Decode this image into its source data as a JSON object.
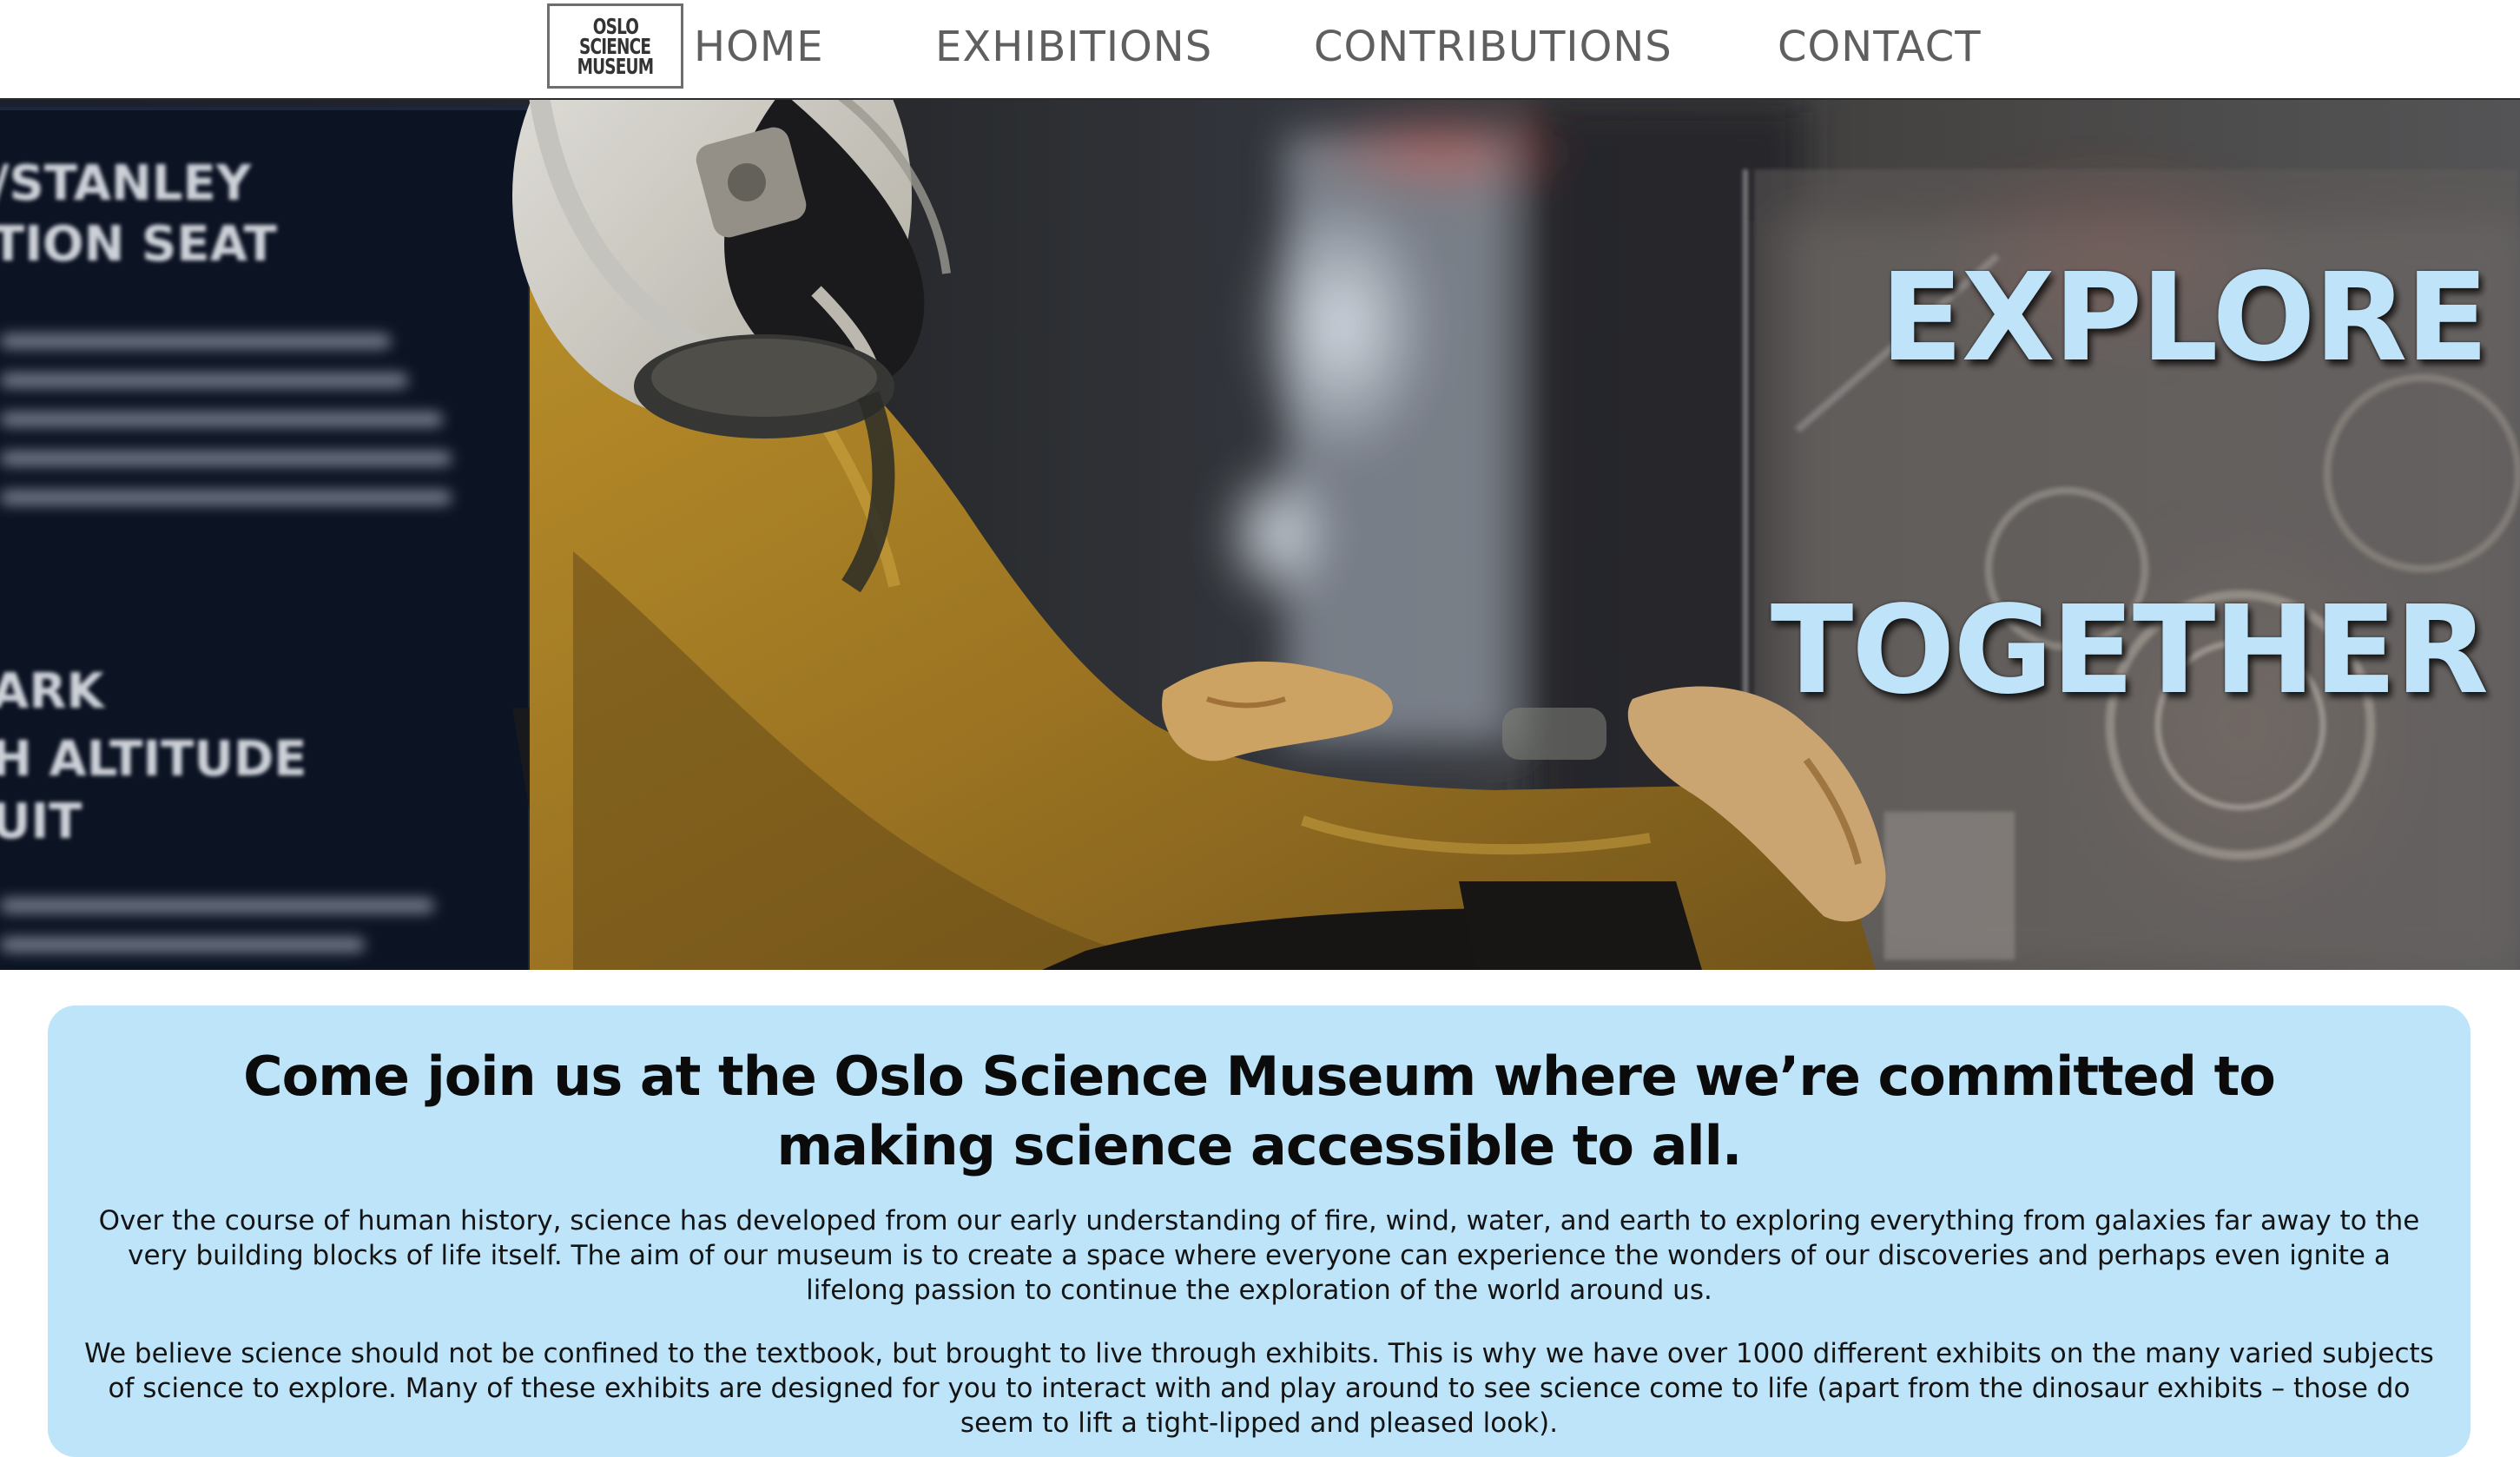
{
  "nav": {
    "logo": {
      "line1": "OSLO",
      "line2": "SCIENCE",
      "line3": "MUSEUM"
    },
    "items": [
      {
        "label": "HOME"
      },
      {
        "label": "EXHIBITIONS"
      },
      {
        "label": "CONTRIBUTIONS"
      },
      {
        "label": "CONTACT"
      }
    ]
  },
  "hero": {
    "word1": "EXPLORE",
    "word2": "TOGETHER",
    "image_subject": "pilot in yellow flight suit and helmet seated in a cockpit exhibit",
    "placard_text": {
      "line1": "/STANLEY",
      "line2": "TION SEAT",
      "line3": "ARK",
      "line4": "H ALTITUDE",
      "line5": "UIT"
    }
  },
  "intro": {
    "heading": "Come join us at the Oslo Science Museum where we’re committed to making science accessible to all.",
    "paragraph1": "Over the course of human history, science has developed from our early understanding of fire, wind, water, and earth to exploring everything from galaxies far away to the very building blocks of life itself. The aim of our museum is to create a space where everyone can experience the wonders of our discoveries and perhaps even ignite a lifelong passion to continue the exploration of the world around us.",
    "paragraph2": "We believe science should not be confined to the textbook, but brought to live through exhibits. This is why we have over 1000 different exhibits on the many varied subjects of science to explore. Many of these exhibits are designed for you to interact with and play around to see science come to life (apart from the dinosaur exhibits – those do seem to lift a tight-lipped and pleased look)."
  },
  "colors": {
    "nav_text": "#5f5f5f",
    "hero_text": "#bfe3f9",
    "card_background": "#bde4f8",
    "heading_text": "#0b0b0b"
  }
}
